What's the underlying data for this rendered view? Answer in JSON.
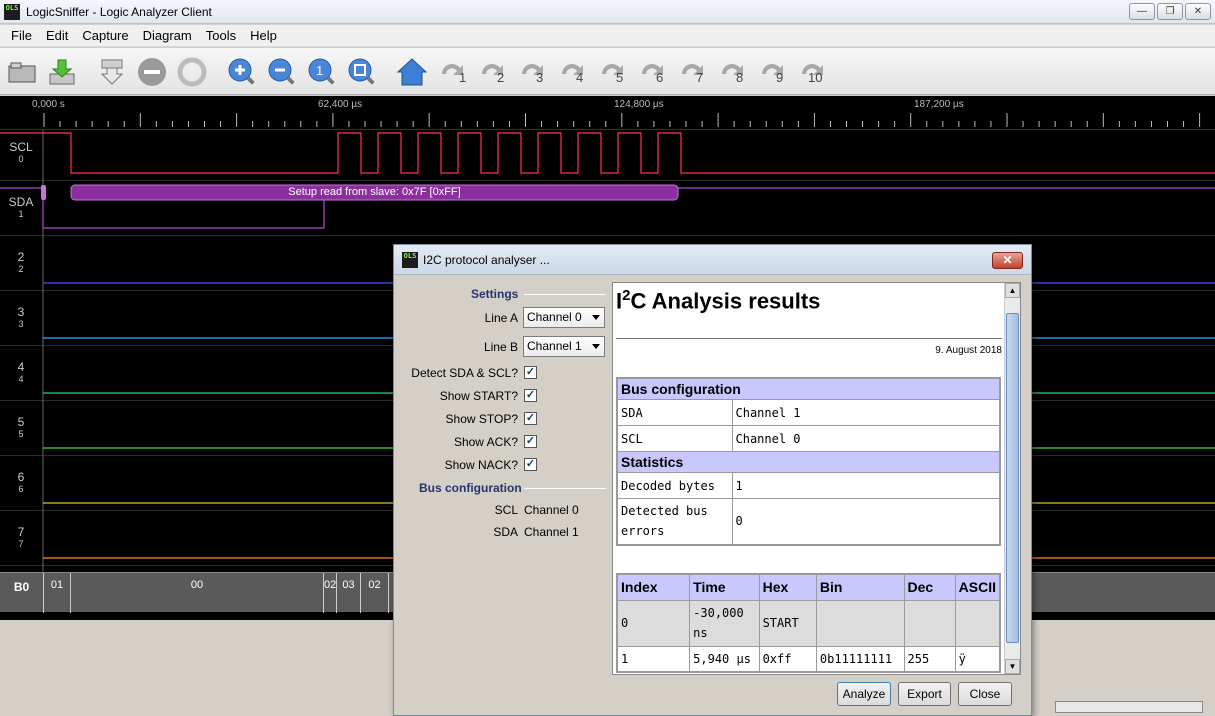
{
  "window": {
    "title": "LogicSniffer - Logic Analyzer Client",
    "icon_text": "OLS",
    "minimize": "—",
    "restore": "❐",
    "close": "✕"
  },
  "menu": [
    "File",
    "Edit",
    "Capture",
    "Diagram",
    "Tools",
    "Help"
  ],
  "toolbar": {
    "markers": [
      "1",
      "2",
      "3",
      "4",
      "5",
      "6",
      "7",
      "8",
      "9",
      "10"
    ]
  },
  "timeline": {
    "labels": [
      "0,000 s",
      "62,400 µs",
      "124,800 µs",
      "187,200 µs"
    ]
  },
  "channels": [
    {
      "name": "SCL",
      "num": "0"
    },
    {
      "name": "SDA",
      "num": "1"
    },
    {
      "name": "2",
      "num": "2"
    },
    {
      "name": "3",
      "num": "3"
    },
    {
      "name": "4",
      "num": "4"
    },
    {
      "name": "5",
      "num": "5"
    },
    {
      "name": "6",
      "num": "6"
    },
    {
      "name": "7",
      "num": "7"
    }
  ],
  "annotation": "Setup read from slave: 0x7F [0xFF]",
  "bus": {
    "name": "B0",
    "cells": [
      "01",
      "00",
      "02",
      "03",
      "02"
    ]
  },
  "colors": {
    "scl": "#ff3355",
    "sda": "#b04ad8",
    "ch2": "#4455ff",
    "ch3": "#33aaff",
    "ch4": "#33cc77",
    "ch5": "#44dd44",
    "ch6": "#c8c833",
    "ch7": "#ff8833"
  },
  "dialog": {
    "title": "I2C protocol analyser ...",
    "close": "✕",
    "settings": {
      "heading": "Settings",
      "line_a_label": "Line A",
      "line_a_value": "Channel 0",
      "line_b_label": "Line B",
      "line_b_value": "Channel 1",
      "checks": [
        {
          "label": "Detect SDA & SCL?",
          "checked": "✓"
        },
        {
          "label": "Show START?",
          "checked": "✓"
        },
        {
          "label": "Show STOP?",
          "checked": "✓"
        },
        {
          "label": "Show ACK?",
          "checked": "✓"
        },
        {
          "label": "Show NACK?",
          "checked": "✓"
        }
      ]
    },
    "busconfig": {
      "heading": "Bus configuration",
      "scl_label": "SCL",
      "scl_value": "Channel 0",
      "sda_label": "SDA",
      "sda_value": "Channel 1"
    },
    "results": {
      "title_main": "I",
      "title_sup": "2",
      "title_rest": "C Analysis results",
      "date": "9. August 2018",
      "bus_heading": "Bus configuration",
      "bus_rows": [
        {
          "k": "SDA",
          "v": "Channel 1"
        },
        {
          "k": "SCL",
          "v": "Channel 0"
        }
      ],
      "stats_heading": "Statistics",
      "stats_rows": [
        {
          "k": "Decoded bytes",
          "v": "1"
        },
        {
          "k": "Detected bus errors",
          "v": "0"
        }
      ],
      "columns": [
        "Index",
        "Time",
        "Hex",
        "Bin",
        "Dec",
        "ASCII"
      ],
      "rows": [
        [
          "0",
          "-30,000 ns",
          "START",
          "",
          "",
          ""
        ],
        [
          "1",
          "5,940 µs",
          "0xff",
          "0b11111111",
          "255",
          "ÿ"
        ]
      ]
    },
    "buttons": {
      "analyze": "Analyze",
      "export": "Export",
      "close": "Close"
    }
  }
}
